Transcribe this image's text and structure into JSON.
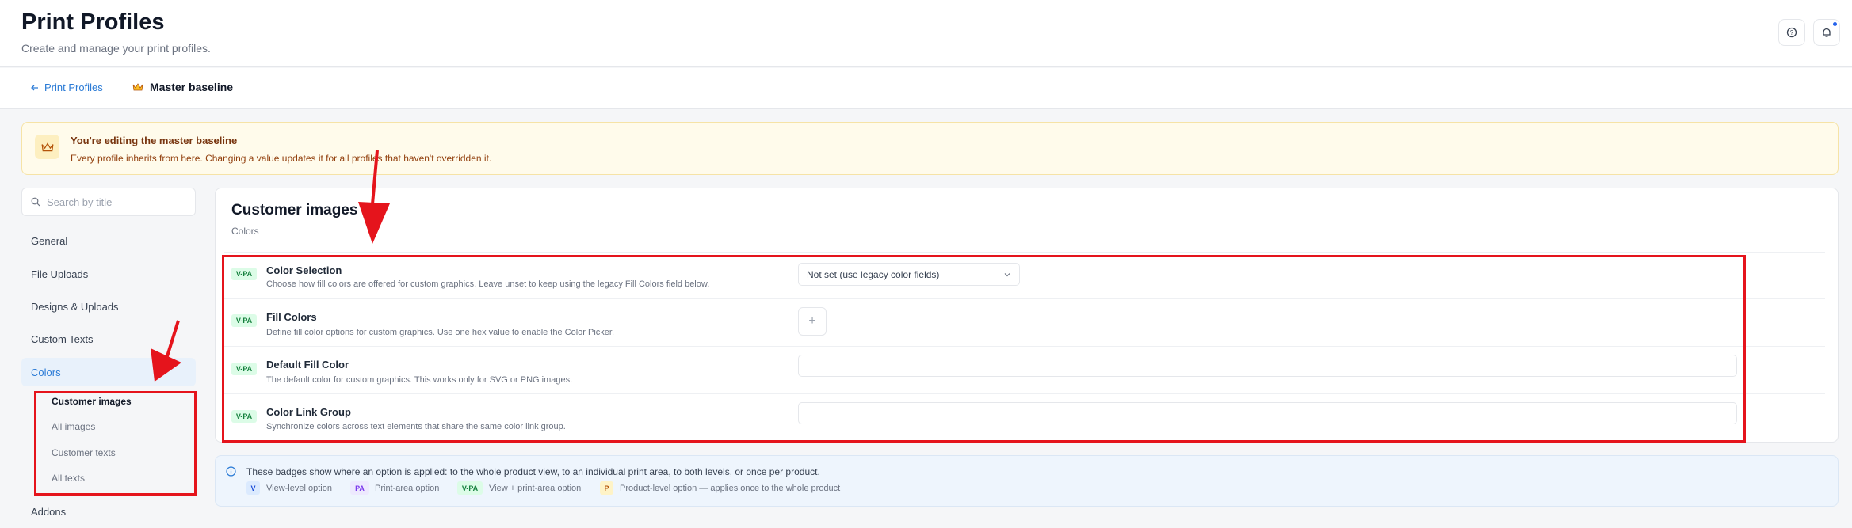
{
  "header": {
    "title": "Print Profiles",
    "subtitle": "Create and manage your print profiles."
  },
  "breadcrumb": {
    "back_label": "Print Profiles",
    "current_label": "Master baseline"
  },
  "banner": {
    "title": "You're editing the master baseline",
    "text": "Every profile inherits from here. Changing a value updates it for all profiles that haven't overridden it."
  },
  "search": {
    "placeholder": "Search by title"
  },
  "nav": {
    "items": [
      "General",
      "File Uploads",
      "Designs & Uploads",
      "Custom Texts",
      "Colors",
      "Addons"
    ],
    "sub_items": [
      "Customer images",
      "All images",
      "Customer texts",
      "All texts"
    ]
  },
  "section": {
    "title": "Customer images",
    "subtitle": "Colors"
  },
  "options": [
    {
      "badge": "V-PA",
      "label": "Color Selection",
      "desc": "Choose how fill colors are offered for custom graphics. Leave unset to keep using the legacy Fill Colors field below."
    },
    {
      "badge": "V-PA",
      "label": "Fill Colors",
      "desc": "Define fill color options for custom graphics. Use one hex value to enable the Color Picker."
    },
    {
      "badge": "V-PA",
      "label": "Default Fill Color",
      "desc": "The default color for custom graphics. This works only for SVG or PNG images."
    },
    {
      "badge": "V-PA",
      "label": "Color Link Group",
      "desc": "Synchronize colors across text elements that share the same color link group."
    }
  ],
  "color_selection_value": "Not set (use legacy color fields)",
  "add_symbol": "+",
  "info": {
    "text": "These badges show where an option is applied: to the whole product view, to an individual print area, to both levels, or once per product.",
    "legend": [
      {
        "badge": "V",
        "label": "View-level option"
      },
      {
        "badge": "PA",
        "label": "Print-area option"
      },
      {
        "badge": "V-PA",
        "label": "View + print-area option"
      },
      {
        "badge": "P",
        "label": "Product-level option — applies once to the whole product"
      }
    ]
  },
  "colors": {
    "accent": "#2b7bd6",
    "annotation_red": "#e5141c",
    "banner_bg": "#fffbeb",
    "badge_vpa_bg": "#dcfce7"
  }
}
